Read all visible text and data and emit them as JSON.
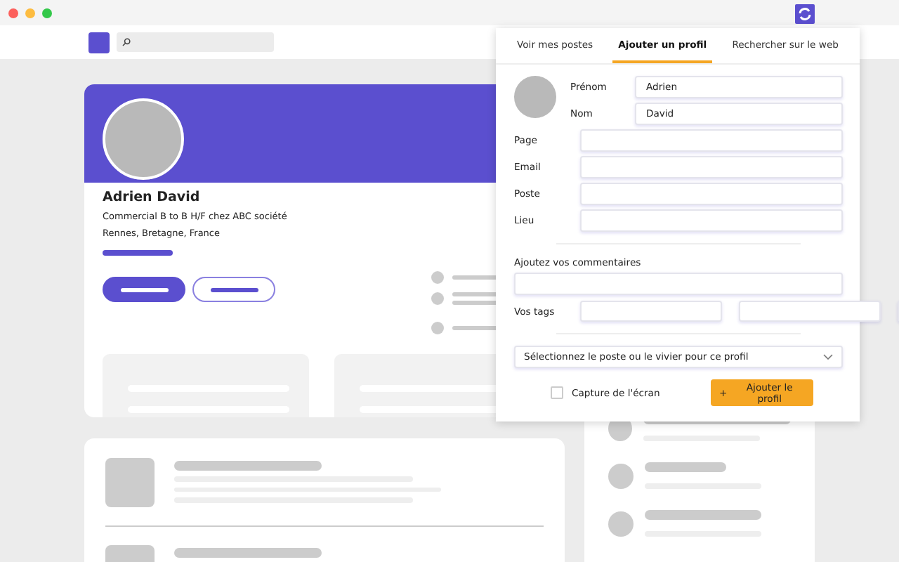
{
  "profile": {
    "name": "Adrien David",
    "headline": "Commercial B to B H/F chez ABC société",
    "location": "Rennes, Bretagne, France"
  },
  "popup": {
    "tabs": [
      {
        "label": "Voir mes postes",
        "selected": false
      },
      {
        "label": "Ajouter un profil",
        "selected": true
      },
      {
        "label": "Rechercher sur le web",
        "selected": false
      }
    ],
    "name_fields": [
      {
        "label": "Prénom",
        "value": "Adrien"
      },
      {
        "label": "Nom",
        "value": "David"
      }
    ],
    "fields": [
      {
        "label": "Page"
      },
      {
        "label": "Email"
      },
      {
        "label": "Poste"
      },
      {
        "label": "Lieu"
      }
    ],
    "comments": {
      "label": "Ajoutez vos commentaires"
    },
    "tags": {
      "label": "Vos tags"
    },
    "select": {
      "placeholder": "Sélectionnez le poste ou le vivier pour ce profil"
    },
    "screenshot": {
      "label": "Capture de l'écran",
      "checked": false
    },
    "add_button": {
      "icon": "+",
      "label": "Ajouter le profil"
    }
  }
}
